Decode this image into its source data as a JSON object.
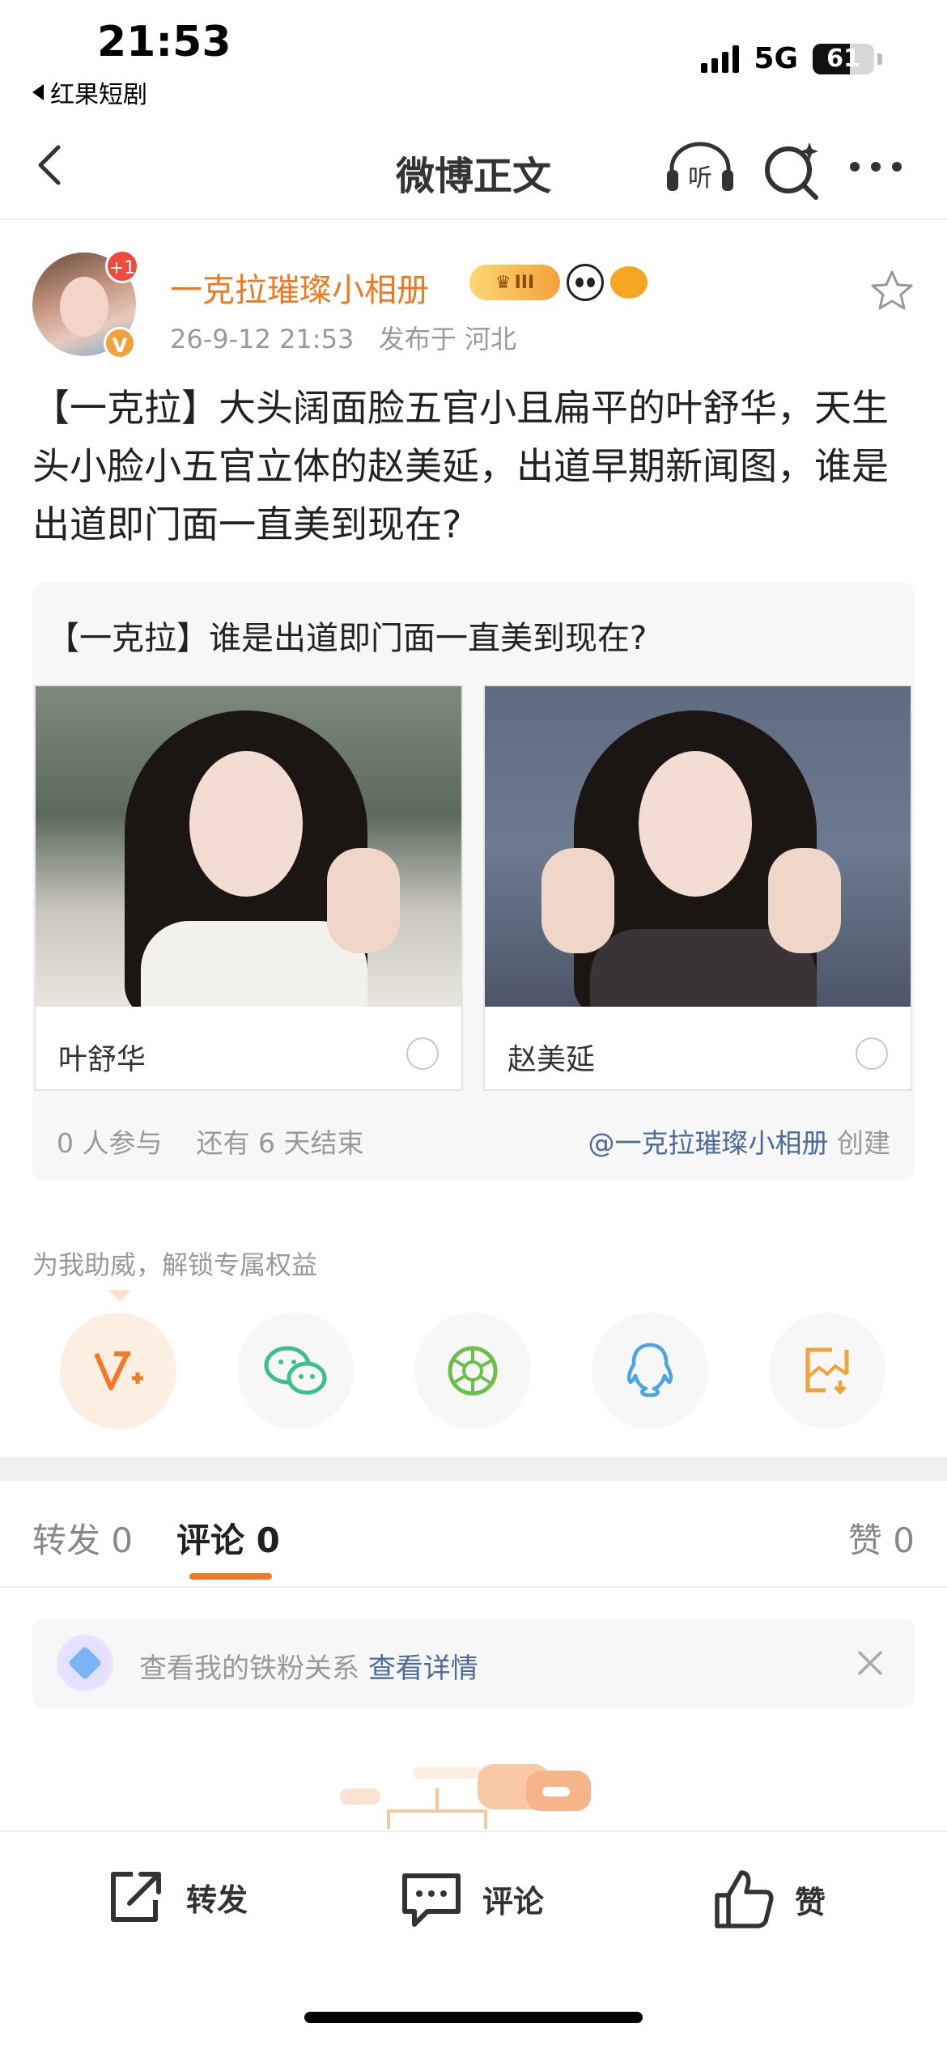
{
  "status_bar": {
    "time": "21:53",
    "back_app": "红果短剧",
    "network": "5G",
    "battery": "61",
    "battery_fraction": 0.61
  },
  "nav": {
    "title": "微博正文",
    "listen_label": "听",
    "icons": [
      "back-arrow-icon",
      "listen-headphone-icon",
      "search-sparkle-icon",
      "more-dots-icon"
    ]
  },
  "author": {
    "name": "一克拉璀璨小相册",
    "avatar_badge": "+1",
    "verified_badge": "V",
    "rank_badge": "III",
    "time": "26-9-12 21:53",
    "location": "发布于 河北"
  },
  "post": {
    "text": "【一克拉】大头阔面脸五官小且扁平的叶舒华，天生头小脸小五官立体的赵美延，出道早期新闻图，谁是出道即门面一直美到现在?"
  },
  "poll": {
    "title": "【一克拉】谁是出道即门面一直美到现在?",
    "options": [
      {
        "label": "叶舒华"
      },
      {
        "label": "赵美延"
      }
    ],
    "participants": "0 人参与",
    "remaining": "还有 6 天结束",
    "creator_at": "@一克拉璀璨小相册",
    "creator_suffix": "创建"
  },
  "support": {
    "text": "为我助威，解锁专属权益",
    "share_icons": [
      "vip-plus-icon",
      "wechat-icon",
      "moments-icon",
      "qq-icon",
      "save-image-icon"
    ]
  },
  "tabs": {
    "repost": "转发 0",
    "comment": "评论 0",
    "like": "赞 0"
  },
  "fan_banner": {
    "text": "查看我的铁粉关系",
    "link": "查看详情"
  },
  "bottom_bar": {
    "repost": "转发",
    "comment": "评论",
    "like": "赞"
  },
  "colors": {
    "accent_orange": "#f07a28",
    "link_blue": "#4d6a9e",
    "wechat_green": "#3cc08a",
    "qq_blue": "#4aa4e6",
    "save_orange": "#f3a13a"
  }
}
